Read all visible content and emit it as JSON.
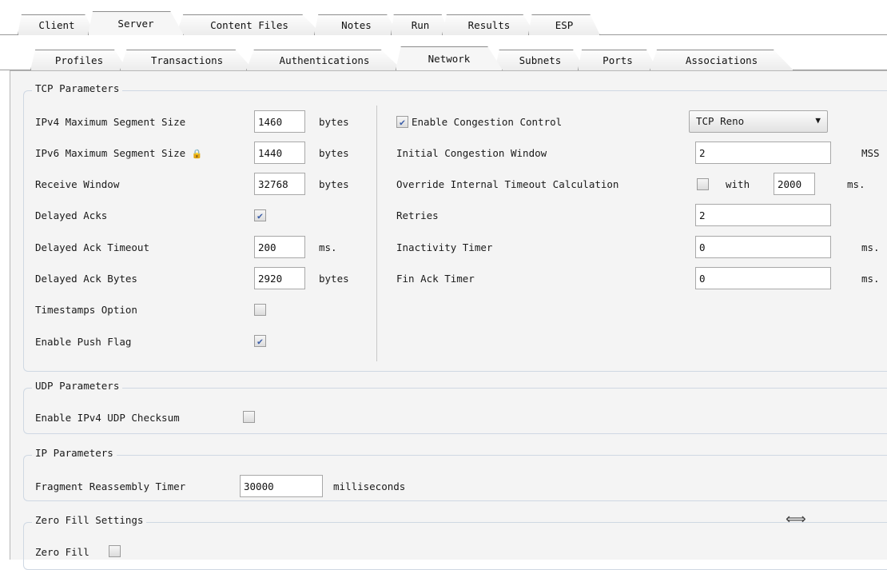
{
  "tabs_top": [
    {
      "label": "Client",
      "active": false
    },
    {
      "label": "Server",
      "active": true
    },
    {
      "label": "Content Files",
      "active": false
    },
    {
      "label": "Notes",
      "active": false
    },
    {
      "label": "Run",
      "active": false
    },
    {
      "label": "Results",
      "active": false
    },
    {
      "label": "ESP",
      "active": false
    }
  ],
  "tabs_sub": [
    {
      "label": "Profiles",
      "active": false
    },
    {
      "label": "Transactions",
      "active": false
    },
    {
      "label": "Authentications",
      "active": false
    },
    {
      "label": "Network",
      "active": true
    },
    {
      "label": "Subnets",
      "active": false
    },
    {
      "label": "Ports",
      "active": false
    },
    {
      "label": "Associations",
      "active": false
    }
  ],
  "tcp": {
    "title": "TCP Parameters",
    "ipv4_mss": {
      "label": "IPv4 Maximum Segment Size",
      "value": "1460",
      "unit": "bytes"
    },
    "ipv6_mss": {
      "label": "IPv6 Maximum Segment Size",
      "value": "1440",
      "unit": "bytes"
    },
    "receive_window": {
      "label": "Receive Window",
      "value": "32768",
      "unit": "bytes"
    },
    "delayed_acks": {
      "label": "Delayed Acks",
      "checked": true
    },
    "delayed_ack_timeout": {
      "label": "Delayed Ack Timeout",
      "value": "200",
      "unit": "ms."
    },
    "delayed_ack_bytes": {
      "label": "Delayed Ack Bytes",
      "value": "2920",
      "unit": "bytes"
    },
    "timestamps_option": {
      "label": "Timestamps Option",
      "checked": false
    },
    "enable_push_flag": {
      "label": "Enable Push Flag",
      "checked": true
    },
    "congestion_control": {
      "label": "Enable Congestion Control",
      "checked": true,
      "selected": "TCP Reno"
    },
    "initial_cwnd": {
      "label": "Initial Congestion Window",
      "value": "2",
      "unit": "MSS"
    },
    "override_timeout": {
      "label": "Override Internal Timeout Calculation",
      "checked": false,
      "with_label": "with",
      "value": "2000",
      "unit": "ms."
    },
    "retries": {
      "label": "Retries",
      "value": "2"
    },
    "inactivity_timer": {
      "label": "Inactivity Timer",
      "value": "0",
      "unit": "ms."
    },
    "fin_ack_timer": {
      "label": "Fin Ack Timer",
      "value": "0",
      "unit": "ms."
    }
  },
  "udp": {
    "title": "UDP Parameters",
    "checksum": {
      "label": "Enable IPv4 UDP Checksum",
      "checked": false
    }
  },
  "ip": {
    "title": "IP Parameters",
    "fragment_timer": {
      "label": "Fragment Reassembly Timer",
      "value": "30000",
      "unit": "milliseconds"
    }
  },
  "zero_fill": {
    "title": "Zero Fill Settings",
    "zero_fill": {
      "label": "Zero Fill",
      "checked": false
    }
  },
  "icons": {
    "lock": "lock-icon",
    "resize": "resize-horizontal-icon",
    "dropdown": "chevron-down-icon",
    "check": "checkmark-icon"
  }
}
